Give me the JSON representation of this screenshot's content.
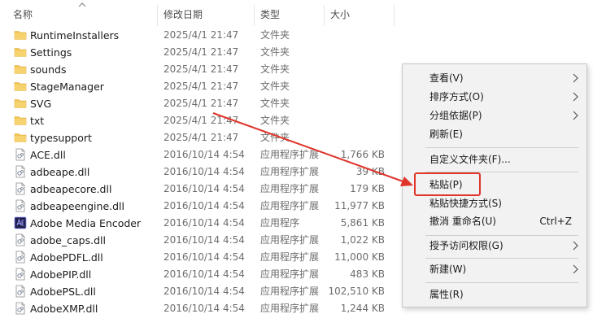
{
  "columns": {
    "name": "名称",
    "date": "修改日期",
    "type": "类型",
    "size": "大小"
  },
  "files": [
    {
      "name": "RuntimeInstallers",
      "date": "2025/4/1 21:47",
      "type": "文件夹",
      "size": "",
      "icon": "folder-icon"
    },
    {
      "name": "Settings",
      "date": "2025/4/1 21:47",
      "type": "文件夹",
      "size": "",
      "icon": "folder-icon"
    },
    {
      "name": "sounds",
      "date": "2025/4/1 21:47",
      "type": "文件夹",
      "size": "",
      "icon": "folder-icon"
    },
    {
      "name": "StageManager",
      "date": "2025/4/1 21:47",
      "type": "文件夹",
      "size": "",
      "icon": "folder-icon"
    },
    {
      "name": "SVG",
      "date": "2025/4/1 21:47",
      "type": "文件夹",
      "size": "",
      "icon": "folder-icon"
    },
    {
      "name": "txt",
      "date": "2025/4/1 21:47",
      "type": "文件夹",
      "size": "",
      "icon": "folder-icon"
    },
    {
      "name": "typesupport",
      "date": "2025/4/1 21:47",
      "type": "文件夹",
      "size": "",
      "icon": "folder-icon"
    },
    {
      "name": "ACE.dll",
      "date": "2016/10/14 4:54",
      "type": "应用程序扩展",
      "size": "1,766 KB",
      "icon": "dll-file-icon"
    },
    {
      "name": "adbeape.dll",
      "date": "2016/10/14 4:54",
      "type": "应用程序扩展",
      "size": "39 KB",
      "icon": "dll-file-icon"
    },
    {
      "name": "adbeapecore.dll",
      "date": "2016/10/14 4:54",
      "type": "应用程序扩展",
      "size": "179 KB",
      "icon": "dll-file-icon"
    },
    {
      "name": "adbeapeengine.dll",
      "date": "2016/10/14 4:54",
      "type": "应用程序扩展",
      "size": "11,977 KB",
      "icon": "dll-file-icon"
    },
    {
      "name": "Adobe Media Encoder",
      "date": "2016/10/14 4:54",
      "type": "应用程序",
      "size": "5,861 KB",
      "icon": "media-encoder-app-icon"
    },
    {
      "name": "adobe_caps.dll",
      "date": "2016/10/14 4:54",
      "type": "应用程序扩展",
      "size": "1,022 KB",
      "icon": "dll-file-icon"
    },
    {
      "name": "AdobePDFL.dll",
      "date": "2016/10/14 4:54",
      "type": "应用程序扩展",
      "size": "11,000 KB",
      "icon": "dll-file-icon"
    },
    {
      "name": "AdobePIP.dll",
      "date": "2016/10/14 4:54",
      "type": "应用程序扩展",
      "size": "483 KB",
      "icon": "dll-file-icon"
    },
    {
      "name": "AdobePSL.dll",
      "date": "2016/10/14 4:54",
      "type": "应用程序扩展",
      "size": "102,510 KB",
      "icon": "dll-file-icon"
    },
    {
      "name": "AdobeXMP.dll",
      "date": "2016/10/14 4:54",
      "type": "应用程序扩展",
      "size": "1,244 KB",
      "icon": "dll-file-icon"
    }
  ],
  "context_menu": {
    "view": "查看(V)",
    "sort_by": "排序方式(O)",
    "group_by": "分组依据(P)",
    "refresh": "刷新(E)",
    "customize_folder": "自定义文件夹(F)...",
    "paste": "粘贴(P)",
    "paste_shortcut": "粘贴快捷方式(S)",
    "undo_rename": "撤消 重命名(U)",
    "undo_shortcut": "Ctrl+Z",
    "grant_access": "授予访问权限(G)",
    "new": "新建(W)",
    "properties": "属性(R)"
  },
  "colors": {
    "annotation_red": "#e0352b",
    "folder": "#f2c94c",
    "menu_bg": "#f2f2f2"
  }
}
